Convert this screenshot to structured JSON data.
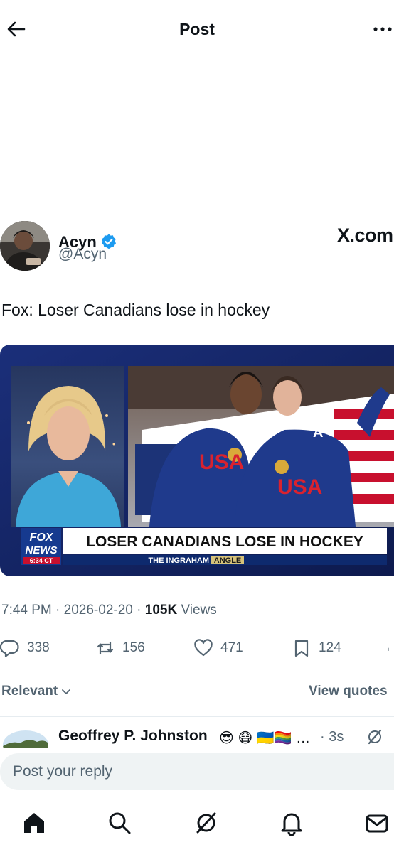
{
  "header": {
    "title": "Post"
  },
  "post": {
    "author_name": "Acyn",
    "author_handle": "@Acyn",
    "source_logo": "X.com",
    "text": "Fox: Loser Canadians lose in hockey",
    "media": {
      "chyron": "LOSER CANADIANS LOSE IN HOCKEY",
      "network_logo_line1": "FOX",
      "network_logo_line2": "NEWS",
      "time_bug": "6:34 CT",
      "show_name_1": "THE INGRAHAM",
      "show_name_2": "ANGLE",
      "jersey_text_left": "USA",
      "jersey_text_right": "USA",
      "jersey_letter": "A"
    },
    "time": "7:44 PM",
    "date": "2026-02-20",
    "views_count": "105K",
    "views_label": " Views",
    "stats": {
      "replies": "338",
      "reposts": "156",
      "likes": "471",
      "bookmarks": "124"
    }
  },
  "sort": {
    "label": "Relevant",
    "view_quotes": "View quotes"
  },
  "reply_preview": {
    "name": "Geoffrey P. Johnston",
    "emojis": "😎 😷 🇺🇦🏳️‍🌈 …",
    "time": "· 3s"
  },
  "composer": {
    "placeholder": "Post your reply"
  },
  "colors": {
    "text": "#0f1419",
    "secondary": "#536471",
    "verified_blue": "#1d9bf0",
    "composer_bg": "#eff3f4",
    "divider": "#e6ecf0"
  },
  "icons": {
    "back": "arrow-left-icon",
    "more": "more-horizontal-icon",
    "verified": "verified-badge-icon",
    "reply": "reply-icon",
    "repost": "repost-icon",
    "like": "heart-icon",
    "bookmark": "bookmark-icon",
    "chevron": "chevron-down-icon",
    "grok": "grok-icon",
    "home": "home-icon",
    "search": "search-icon",
    "notifications": "bell-icon",
    "messages": "mail-icon"
  }
}
